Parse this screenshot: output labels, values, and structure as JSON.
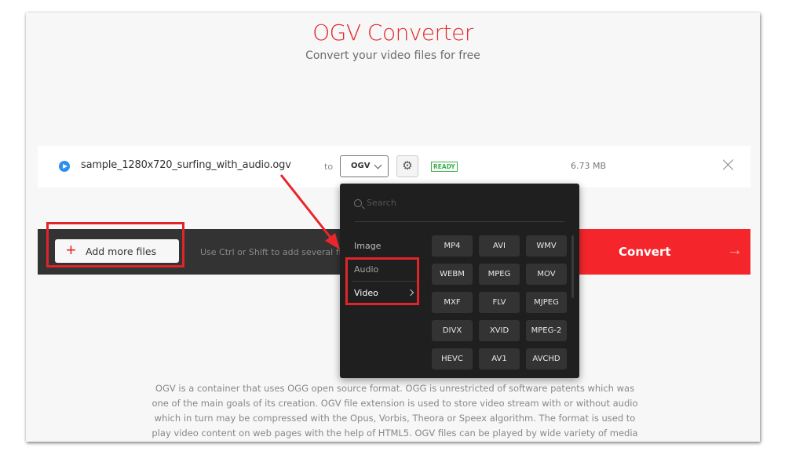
{
  "header": {
    "title": "OGV Converter",
    "subtitle": "Convert your video files for free"
  },
  "file": {
    "name": "sample_1280x720_surfing_with_audio.ogv",
    "to_label": "to",
    "target_format": "OGV",
    "status": "READY",
    "size": "6.73 MB"
  },
  "actions": {
    "add_more_label": "Add more files",
    "hint": "Use Ctrl or Shift to add several files a",
    "convert_label": "Convert"
  },
  "dropdown": {
    "search_placeholder": "Search",
    "categories": [
      {
        "label": "Image"
      },
      {
        "label": "Audio"
      },
      {
        "label": "Video",
        "selected": true
      }
    ],
    "formats": [
      "MP4",
      "AVI",
      "WMV",
      "WEBM",
      "MPEG",
      "MOV",
      "MXF",
      "FLV",
      "MJPEG",
      "DIVX",
      "XVID",
      "MPEG-2",
      "HEVC",
      "AV1",
      "AVCHD"
    ]
  },
  "description": "OGV is a container that uses OGG open source format. OGG is unrestricted of software patents which was one of the main goals of its creation. OGV file extension is used to store video stream with or without audio which in turn may be compressed with the Opus, Vorbis, Theora or Speex algorithm. The format is used to play video content on web pages with the help of HTML5. OGV files can be played by wide variety of media players.",
  "colors": {
    "brand_red": "#e3262b",
    "convert_red": "#f5262b",
    "ready_green": "#3bb14a",
    "dark_bar": "#333333",
    "dropdown_bg": "#1f1f1f"
  }
}
